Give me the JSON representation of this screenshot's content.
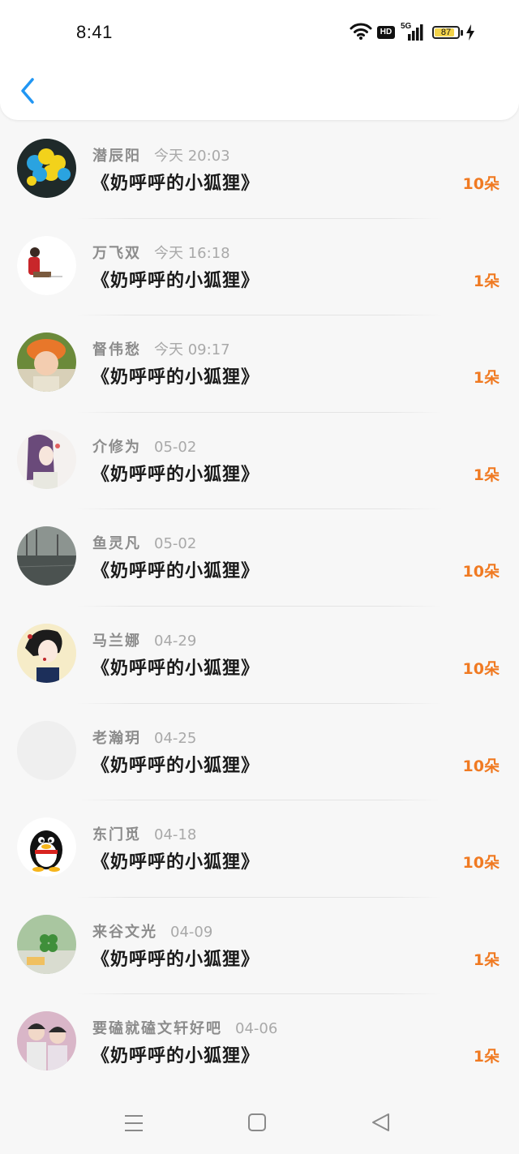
{
  "status_bar": {
    "time": "8:41",
    "hd_label": "HD",
    "network_label": "5G",
    "battery": "87",
    "battery_level": 0.87
  },
  "header": {
    "back_icon": "chevron-left-icon"
  },
  "colors": {
    "accent": "#2196f3",
    "amount": "#f07a22",
    "name": "#8c8c8c",
    "date": "#a9a9a9",
    "title": "#1a1a1a"
  },
  "gifts": [
    {
      "name": "潜辰阳",
      "date": "今天 20:03",
      "title": "《奶呼呼的小狐狸》",
      "amount": "10朵",
      "avatar": "balloons-avatar"
    },
    {
      "name": "万飞双",
      "date": "今天 16:18",
      "title": "《奶呼呼的小狐狸》",
      "amount": "1朵",
      "avatar": "sitting-person-avatar"
    },
    {
      "name": "督伟愁",
      "date": "今天 09:17",
      "title": "《奶呼呼的小狐狸》",
      "amount": "1朵",
      "avatar": "child-orange-hat-avatar"
    },
    {
      "name": "介修为",
      "date": "05-02",
      "title": "《奶呼呼的小狐狸》",
      "amount": "1朵",
      "avatar": "anime-girl-avatar"
    },
    {
      "name": "鱼灵凡",
      "date": "05-02",
      "title": "《奶呼呼的小狐狸》",
      "amount": "10朵",
      "avatar": "lake-scene-avatar"
    },
    {
      "name": "马兰娜",
      "date": "04-29",
      "title": "《奶呼呼的小狐狸》",
      "amount": "10朵",
      "avatar": "illustrated-woman-avatar"
    },
    {
      "name": "老瀚玥",
      "date": "04-25",
      "title": "《奶呼呼的小狐狸》",
      "amount": "10朵",
      "avatar": "blank-avatar"
    },
    {
      "name": "东门觅",
      "date": "04-18",
      "title": "《奶呼呼的小狐狸》",
      "amount": "10朵",
      "avatar": "penguin-avatar"
    },
    {
      "name": "来谷文光",
      "date": "04-09",
      "title": "《奶呼呼的小狐狸》",
      "amount": "1朵",
      "avatar": "clover-avatar"
    },
    {
      "name": "要磕就磕文轩好吧",
      "date": "04-06",
      "title": "《奶呼呼的小狐狸》",
      "amount": "1朵",
      "avatar": "two-boys-avatar"
    }
  ],
  "nav_bar": {
    "menu_icon": "menu-icon",
    "home_icon": "home-square-icon",
    "back_icon": "back-triangle-icon"
  }
}
